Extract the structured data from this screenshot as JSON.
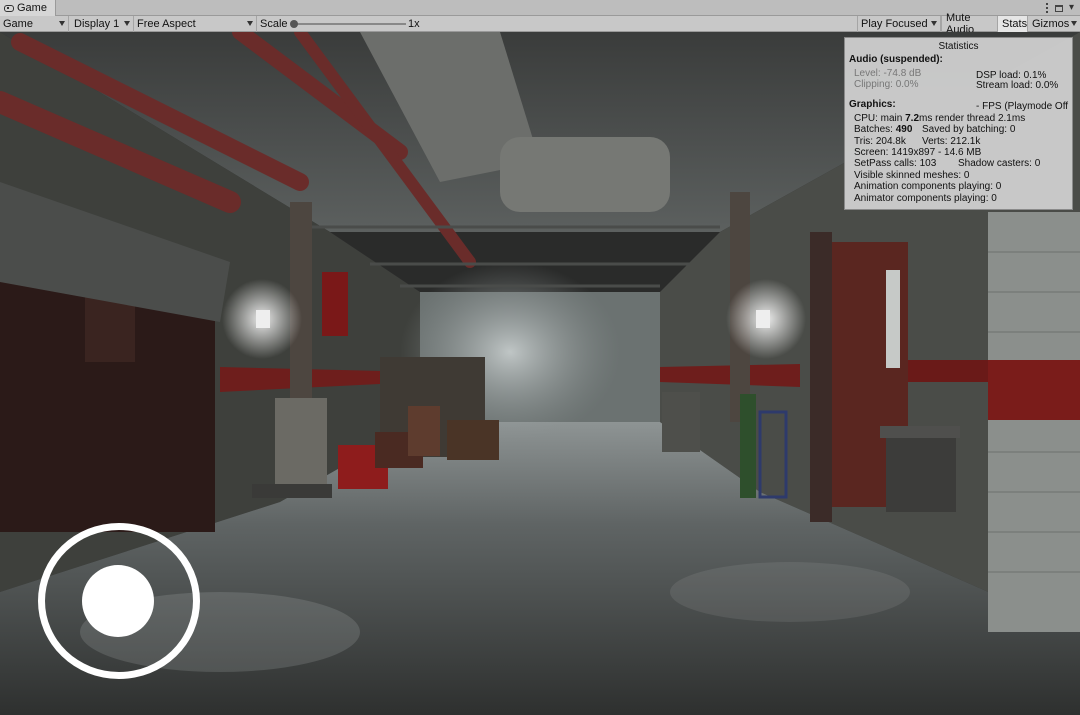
{
  "window": {
    "tab_label": "Game",
    "tab_icon": "game-controller-icon"
  },
  "toolbar": {
    "view_mode": "Game",
    "display": "Display 1",
    "aspect": "Free Aspect",
    "scale_label": "Scale",
    "scale_value": "1x",
    "scale_level": 0.0,
    "play_mode": "Play Focused",
    "mute_audio": "Mute Audio",
    "stats": "Stats",
    "gizmos": "Gizmos"
  },
  "stats": {
    "title": "Statistics",
    "audio_heading": "Audio (suspended):",
    "level": "Level: -74.8 dB",
    "clipping": "Clipping: 0.0%",
    "dsp_load": "DSP load: 0.1%",
    "stream_load": "Stream load: 0.0%",
    "graphics_heading": "Graphics:",
    "fps": "- FPS (Playmode Off",
    "cpu_prefix": "CPU: main ",
    "cpu_main": "7.2",
    "cpu_suffix": "ms  render thread 2.1ms",
    "batches_prefix": "Batches: ",
    "batches": "490",
    "saved_batching": "Saved by batching: 0",
    "tris": "Tris: 204.8k",
    "verts": "Verts: 212.1k",
    "screen": "Screen: 1419x897 - 14.6 MB",
    "setpass": "SetPass calls: 103",
    "shadow_casters": "Shadow casters: 0",
    "skinned": "Visible skinned meshes: 0",
    "animation": "Animation components playing: 0",
    "animator": "Animator components playing: 0"
  },
  "colors": {
    "toolbar_bg": "#c8c8c8",
    "stats_bg": "#d2d2d2",
    "red_stripe": "#7a1c1a",
    "joystick": "#ffffff"
  }
}
